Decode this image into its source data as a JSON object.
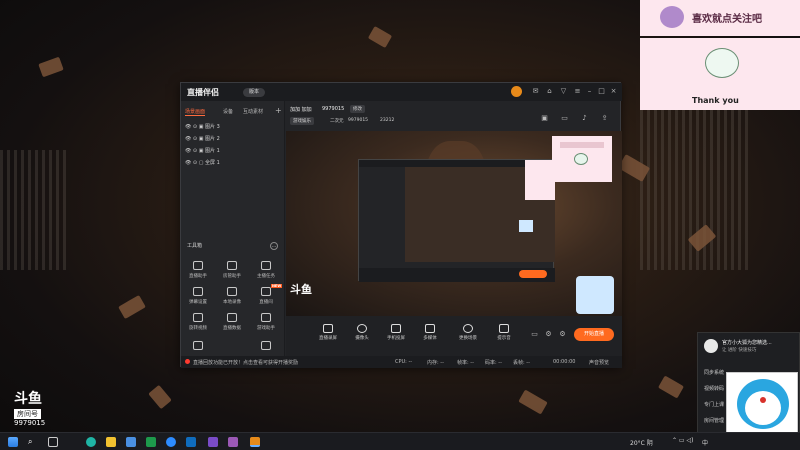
{
  "app": {
    "logo_text": "直播伴侣",
    "badge": "版本",
    "tabs": [
      "场景画面",
      "设备",
      "互动素材"
    ],
    "add_symbol": "+",
    "scenes": [
      {
        "label": "图片 3"
      },
      {
        "label": "图片 2"
      },
      {
        "label": "图片 1"
      },
      {
        "label": "全屏 1"
      }
    ],
    "tools_title": "工具箱",
    "tools": [
      {
        "label": "直播助手",
        "icon": "assistant-icon"
      },
      {
        "label": "房管助手",
        "icon": "user-icon"
      },
      {
        "label": "主播任务",
        "icon": "task-icon"
      },
      {
        "label": "弹幕设置",
        "icon": "danmaku-icon"
      },
      {
        "label": "本地录像",
        "icon": "download-icon"
      },
      {
        "label": "直播间",
        "icon": "room-icon",
        "badge": "NEW"
      },
      {
        "label": "旋转视频",
        "icon": "rotate-icon"
      },
      {
        "label": "直播数据",
        "icon": "data-icon"
      },
      {
        "label": "游戏助手",
        "icon": "game-icon"
      }
    ],
    "notice": "直播回放功能已开放！点击查看可获得开播奖励",
    "streamer": {
      "name": "加加 加加",
      "id": "9979015",
      "tag": "修改",
      "subtitle": "游戏娱乐",
      "category": "二次元",
      "room": "9979015",
      "heat": "23212"
    },
    "controls": [
      "直播录屏",
      "摄像头",
      "手机投屏",
      "多媒体",
      "更换场景",
      "提示音"
    ],
    "start_button": "开始直播",
    "status": [
      "CPU: --",
      "内存: --",
      "帧率: --",
      "码率: --",
      "丢帧: --"
    ],
    "time": "00:00:00",
    "status_right": "声音预览"
  },
  "overlay_top": {
    "title": "喜欢就点关注吧",
    "thank": "Thank you"
  },
  "douyu": {
    "logo": "斗鱼",
    "sub": "房间号",
    "room": "9979015"
  },
  "popup": {
    "title": "官方小大狐为您精选...",
    "subtitle": "让 进阶 快速技巧",
    "items": [
      "同步系统",
      "视频转码",
      "专门上课",
      "房间管理"
    ]
  },
  "taskbar": {
    "weather": "20°C 阴",
    "ime": "中",
    "time": "...",
    "icons": [
      "start-icon",
      "search-icon",
      "taskview-icon",
      "edge-icon",
      "explorer-icon",
      "store-icon",
      "excel-icon",
      "browser-icon",
      "mail-icon",
      "settings-icon",
      "dex-icon",
      "stream-app-icon"
    ]
  }
}
